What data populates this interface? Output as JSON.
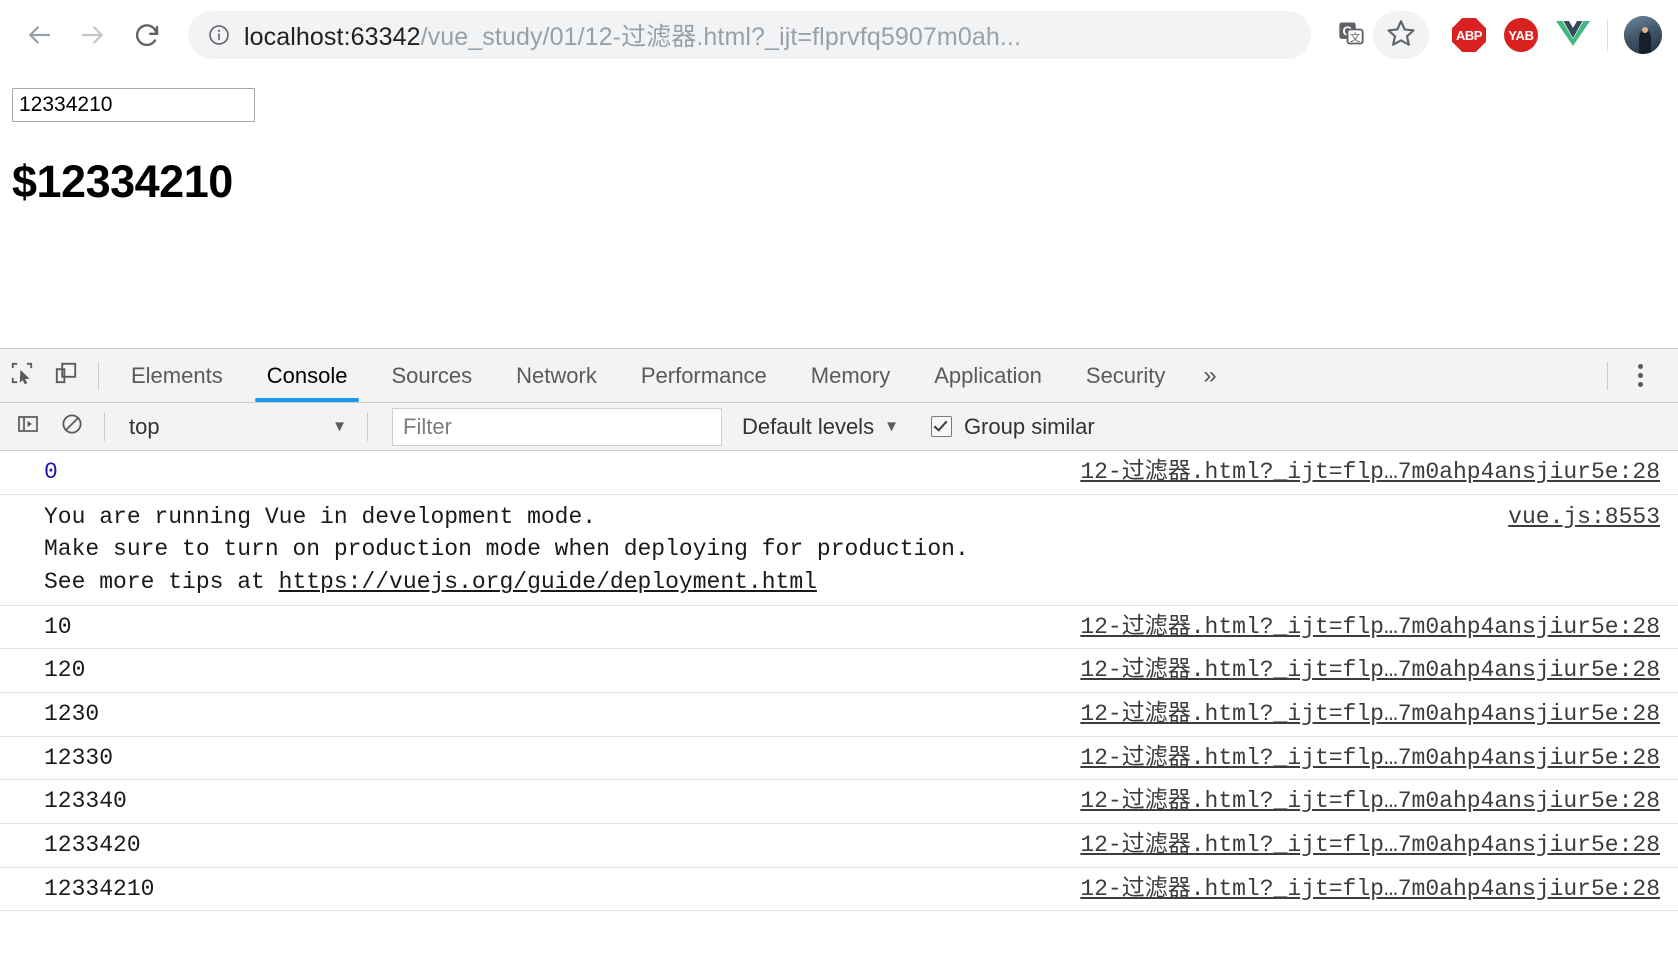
{
  "browser": {
    "back_icon": "arrow-left-icon",
    "forward_icon": "arrow-right-icon",
    "reload_icon": "reload-icon",
    "site_info_icon": "info-circle-icon",
    "url_host": "localhost:63342",
    "url_path": "/vue_study/01/12-过滤器.html?_ijt=flprvfq5907m0ah...",
    "translate_icon": "translate-icon",
    "bookmark_icon": "star-icon",
    "extensions": [
      {
        "name": "adblock-plus-extension",
        "label": "ABP"
      },
      {
        "name": "yandex-adblock-extension",
        "label": "YAB"
      },
      {
        "name": "vue-devtools-extension",
        "label": "V"
      }
    ],
    "avatar_name": "profile-avatar"
  },
  "page": {
    "input_value": "12334210",
    "input_placeholder": "",
    "heading": "$12334210"
  },
  "devtools": {
    "inspect_icon": "inspect-element-icon",
    "device_icon": "device-toolbar-icon",
    "tabs": [
      {
        "label": "Elements",
        "active": false
      },
      {
        "label": "Console",
        "active": true
      },
      {
        "label": "Sources",
        "active": false
      },
      {
        "label": "Network",
        "active": false
      },
      {
        "label": "Performance",
        "active": false
      },
      {
        "label": "Memory",
        "active": false
      },
      {
        "label": "Application",
        "active": false
      },
      {
        "label": "Security",
        "active": false
      }
    ],
    "more_tabs_label": "»",
    "kebab_icon": "more-options-icon",
    "toolbar": {
      "sidebar_icon": "console-sidebar-icon",
      "clear_icon": "clear-console-icon",
      "context_value": "top",
      "context_caret": "▼",
      "filter_placeholder": "Filter",
      "filter_value": "",
      "levels_label": "Default levels",
      "levels_caret": "▼",
      "group_similar_label": "Group similar",
      "group_similar_checked": true
    },
    "accent_color": "#1a9af5",
    "logs": [
      {
        "type": "number",
        "text": "0",
        "source": "12-过滤器.html?_ijt=flp…7m0ahp4ansjiur5e:28"
      },
      {
        "type": "multiline",
        "line1": "You are running Vue in development mode.",
        "line2": "Make sure to turn on production mode when deploying for production.",
        "line3_prefix": "See more tips at ",
        "line3_link": "https://vuejs.org/guide/deployment.html",
        "source": "vue.js:8553"
      },
      {
        "type": "number",
        "text": "10",
        "source": "12-过滤器.html?_ijt=flp…7m0ahp4ansjiur5e:28"
      },
      {
        "type": "number",
        "text": "120",
        "source": "12-过滤器.html?_ijt=flp…7m0ahp4ansjiur5e:28"
      },
      {
        "type": "number",
        "text": "1230",
        "source": "12-过滤器.html?_ijt=flp…7m0ahp4ansjiur5e:28"
      },
      {
        "type": "number",
        "text": "12330",
        "source": "12-过滤器.html?_ijt=flp…7m0ahp4ansjiur5e:28"
      },
      {
        "type": "number",
        "text": "123340",
        "source": "12-过滤器.html?_ijt=flp…7m0ahp4ansjiur5e:28"
      },
      {
        "type": "number",
        "text": "1233420",
        "source": "12-过滤器.html?_ijt=flp…7m0ahp4ansjiur5e:28"
      },
      {
        "type": "number",
        "text": "12334210",
        "source": "12-过滤器.html?_ijt=flp…7m0ahp4ansjiur5e:28"
      }
    ]
  }
}
